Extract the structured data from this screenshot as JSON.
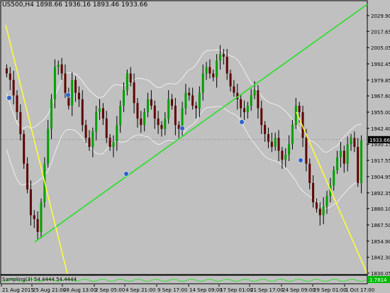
{
  "header": {
    "symbol_label": "US500,H4",
    "ohlc_label": "1898.66 1936.16 1893.46 1933.66"
  },
  "sub_window": {
    "label": "Sampling(3) 54.4444 54.4444"
  },
  "chart_data": {
    "type": "candlestick",
    "price_ticks": [
      "2029.90",
      "2017.65",
      "2005.05",
      "1992.45",
      "1979.85",
      "1967.60",
      "1955.00",
      "1942.40",
      "1930.15",
      "1917.55",
      "1904.95",
      "1892.35",
      "1880.10",
      "1867.50",
      "1854.90",
      "1842.30",
      "1830.05"
    ],
    "ylim": [
      1830.05,
      2029.9
    ],
    "current_price": "1933.66",
    "prev_price_marker": "1930.15",
    "sub_value": "1.7814",
    "time_ticks": [
      "21 Aug 2015",
      "25 Aug 21:00",
      "28 Aug 13:00",
      "2 Sep 05:00",
      "4 Sep 21:00",
      "9 Sep 17:00",
      "14 Sep 09:00",
      "17 Sep 01:00",
      "21 Sep 17:00",
      "24 Sep 09:00",
      "29 Sep 01:00",
      "1 Oct 17:00"
    ],
    "close_series": [
      1985,
      1980,
      1968,
      1955,
      1938,
      1915,
      1895,
      1875,
      1872,
      1862,
      1885,
      1915,
      1942,
      1965,
      1990,
      1992,
      1985,
      1970,
      1960,
      1980,
      1970,
      1965,
      1945,
      1935,
      1928,
      1940,
      1955,
      1958,
      1950,
      1935,
      1928,
      1932,
      1945,
      1960,
      1972,
      1985,
      1978,
      1962,
      1950,
      1945,
      1955,
      1965,
      1960,
      1950,
      1945,
      1942,
      1950,
      1965,
      1960,
      1945,
      1942,
      1958,
      1970,
      1968,
      1960,
      1958,
      1970,
      1985,
      1990,
      1985,
      1982,
      1995,
      2000,
      1998,
      1985,
      1975,
      1970,
      1965,
      1958,
      1955,
      1960,
      1968,
      1972,
      1958,
      1945,
      1938,
      1932,
      1928,
      1935,
      1925,
      1918,
      1922,
      1930,
      1945,
      1960,
      1955,
      1935,
      1915,
      1900,
      1885,
      1880,
      1875,
      1882,
      1890,
      1898,
      1910,
      1920,
      1925,
      1915,
      1930,
      1935,
      1928,
      1900,
      1933
    ],
    "indicator_colors": {
      "candle_up": "#00a000",
      "candle_down": "#600000",
      "wick": "#000000",
      "trend_up_line": "#33dd33",
      "trend_down_line": "#ffff33",
      "envelope": "#ffffff",
      "fractal_marker": "#3366cc",
      "sub_line": "#33dd33",
      "price_tag_bg": "#000000",
      "sub_tag_bg": "#00bb00"
    }
  }
}
